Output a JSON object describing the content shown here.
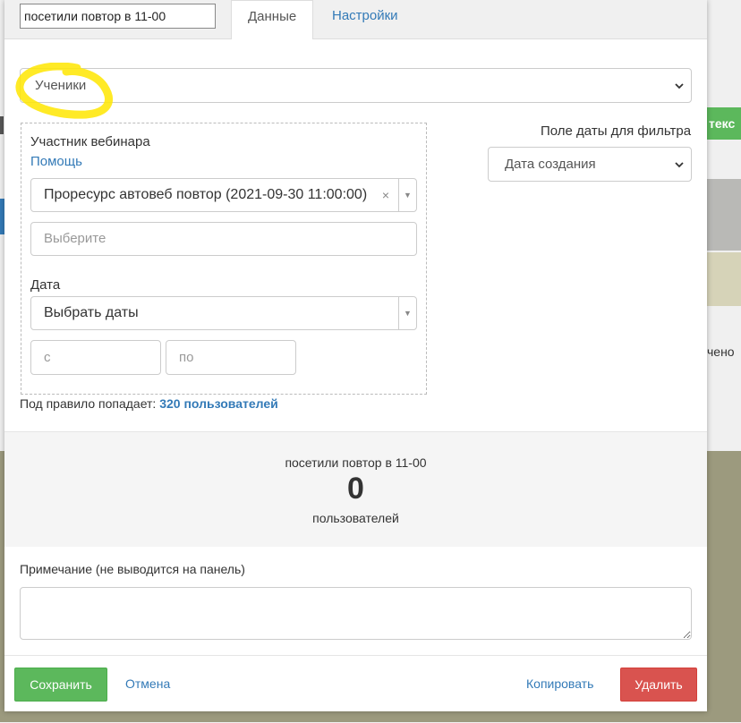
{
  "header": {
    "name_value": "посетили повтор в 11-00",
    "tabs": [
      {
        "label": "Данные"
      },
      {
        "label": "Настройки"
      }
    ]
  },
  "segment_select": {
    "value": "Ученики"
  },
  "date_field_filter": {
    "label": "Поле даты для фильтра",
    "value": "Дата создания"
  },
  "rule": {
    "title": "Участник вебинара",
    "help_link": "Помощь",
    "webinar_value": "Проресурс автовеб повтор (2021-09-30 11:00:00)",
    "clear_symbol": "×",
    "choose_placeholder": "Выберите",
    "date_label": "Дата",
    "date_select_value": "Выбрать даты",
    "from_placeholder": "с",
    "to_placeholder": "по"
  },
  "rule_count": {
    "prefix": "Под правило попадает:",
    "link": "320 пользователей"
  },
  "summary": {
    "name": "посетили повтор в 11-00",
    "count": "0",
    "unit": "пользователей"
  },
  "note": {
    "label": "Примечание (не выводится на панель)"
  },
  "footer": {
    "save": "Сохранить",
    "cancel": "Отмена",
    "copy": "Копировать",
    "delete": "Удалить"
  },
  "background": {
    "green_button_text": "текс",
    "right_text": "чено"
  },
  "colors": {
    "primary_link": "#337ab7",
    "success": "#5cb85c",
    "danger": "#d9534f",
    "highlight": "#ffe600"
  }
}
